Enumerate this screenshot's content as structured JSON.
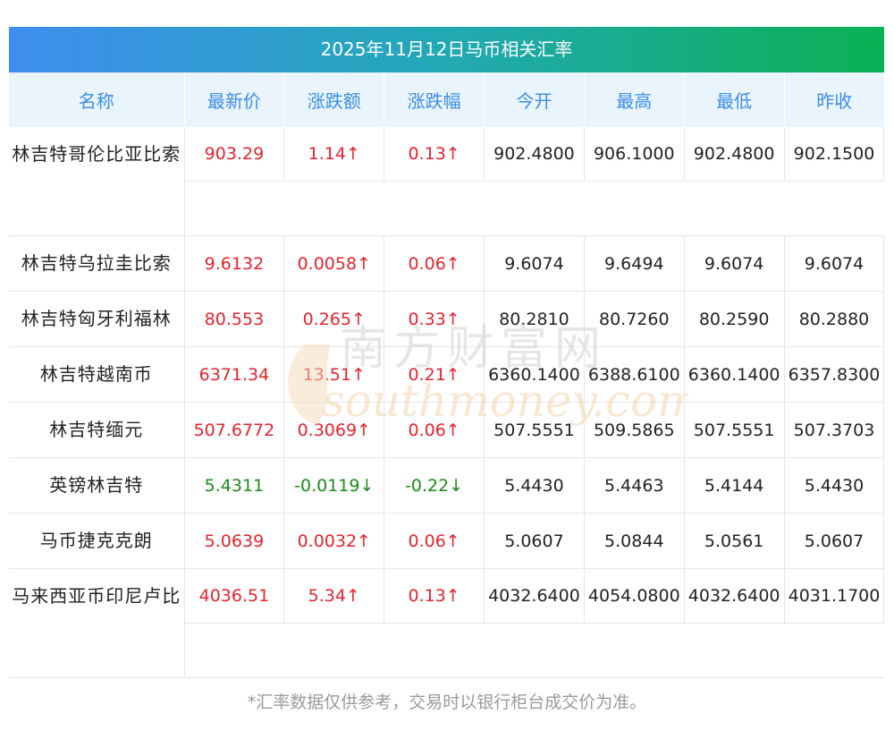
{
  "title": "2025年11月12日马币相关汇率",
  "columns": [
    "名称",
    "最新价",
    "涨跌额",
    "涨跌幅",
    "今开",
    "最高",
    "最低",
    "昨收"
  ],
  "rows": [
    {
      "name": "林吉特哥伦比亚比索",
      "latest": "903.29",
      "change": "1.14↑",
      "pct": "0.13↑",
      "open": "902.4800",
      "high": "906.1000",
      "low": "902.4800",
      "prev": "902.1500",
      "dir": "up",
      "tall": true
    },
    {
      "name": "林吉特乌拉圭比索",
      "latest": "9.6132",
      "change": "0.0058↑",
      "pct": "0.06↑",
      "open": "9.6074",
      "high": "9.6494",
      "low": "9.6074",
      "prev": "9.6074",
      "dir": "up",
      "tall": false
    },
    {
      "name": "林吉特匈牙利福林",
      "latest": "80.553",
      "change": "0.265↑",
      "pct": "0.33↑",
      "open": "80.2810",
      "high": "80.7260",
      "low": "80.2590",
      "prev": "80.2880",
      "dir": "up",
      "tall": false
    },
    {
      "name": "林吉特越南币",
      "latest": "6371.34",
      "change": "13.51↑",
      "pct": "0.21↑",
      "open": "6360.1400",
      "high": "6388.6100",
      "low": "6360.1400",
      "prev": "6357.8300",
      "dir": "up",
      "tall": false
    },
    {
      "name": "林吉特缅元",
      "latest": "507.6772",
      "change": "0.3069↑",
      "pct": "0.06↑",
      "open": "507.5551",
      "high": "509.5865",
      "low": "507.5551",
      "prev": "507.3703",
      "dir": "up",
      "tall": false
    },
    {
      "name": "英镑林吉特",
      "latest": "5.4311",
      "change": "-0.0119↓",
      "pct": "-0.22↓",
      "open": "5.4430",
      "high": "5.4463",
      "low": "5.4144",
      "prev": "5.4430",
      "dir": "down",
      "tall": false
    },
    {
      "name": "马币捷克克朗",
      "latest": "5.0639",
      "change": "0.0032↑",
      "pct": "0.06↑",
      "open": "5.0607",
      "high": "5.0844",
      "low": "5.0561",
      "prev": "5.0607",
      "dir": "up",
      "tall": false
    },
    {
      "name": "马来西亚币印尼卢比",
      "latest": "4036.51",
      "change": "5.34↑",
      "pct": "0.13↑",
      "open": "4032.6400",
      "high": "4054.0800",
      "low": "4032.6400",
      "prev": "4031.1700",
      "dir": "up",
      "tall": true
    }
  ],
  "footnote": "*汇率数据仅供参考，交易时以银行柜台成交价为准。",
  "watermark": {
    "cn": "南方财富网",
    "en": "southmoney.com"
  },
  "colors": {
    "up": "#e6232f",
    "down": "#1a8a1a",
    "header_text": "#3a8ee6",
    "banner_start": "#3f8ef0",
    "banner_end": "#0bb052"
  }
}
